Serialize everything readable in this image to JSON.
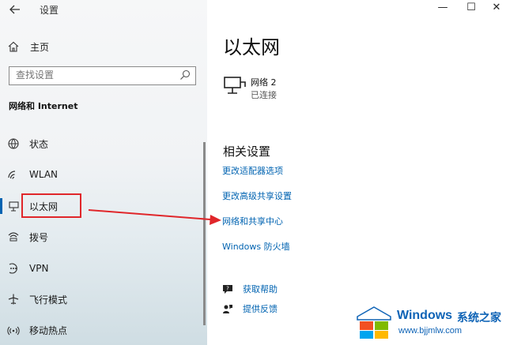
{
  "app": {
    "title": "设置",
    "back_icon": "back-arrow-icon"
  },
  "window_controls": {
    "minimize": "—",
    "maximize": "☐",
    "close": "✕"
  },
  "sidebar": {
    "home_label": "主页",
    "search_placeholder": "查找设置",
    "section_title": "网络和 Internet",
    "items": [
      {
        "label": "状态",
        "icon": "globe-status-icon"
      },
      {
        "label": "WLAN",
        "icon": "wifi-icon"
      },
      {
        "label": "以太网",
        "icon": "ethernet-icon",
        "active": true
      },
      {
        "label": "拨号",
        "icon": "dialup-icon"
      },
      {
        "label": "VPN",
        "icon": "vpn-icon"
      },
      {
        "label": "飞行模式",
        "icon": "airplane-icon"
      },
      {
        "label": "移动热点",
        "icon": "hotspot-icon"
      }
    ]
  },
  "main": {
    "title": "以太网",
    "network": {
      "name": "网络 2",
      "status": "已连接"
    },
    "related_title": "相关设置",
    "links": [
      "更改适配器选项",
      "更改高级共享设置",
      "网络和共享中心",
      "Windows 防火墙"
    ],
    "help": {
      "get_help": "获取帮助",
      "feedback": "提供反馈"
    }
  },
  "watermark": {
    "brand": "Windows",
    "brand_suffix": "系统之家",
    "url": "www.bjjmlw.com"
  },
  "colors": {
    "accent": "#0063b1",
    "highlight": "#e0262a"
  }
}
